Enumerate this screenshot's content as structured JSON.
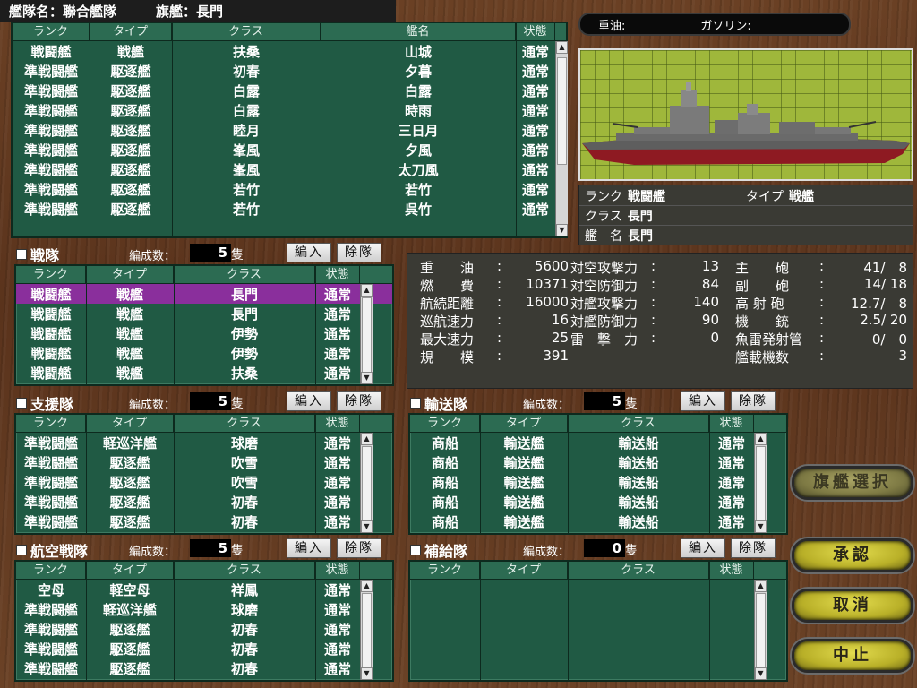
{
  "fleet_header": {
    "name_label": "艦隊名：",
    "name": "聯合艦隊",
    "flagship_label": "旗艦：",
    "flagship": "長門"
  },
  "top_list": {
    "headers": [
      "ランク",
      "タイプ",
      "クラス",
      "艦名",
      "状態"
    ],
    "rows": [
      [
        "戦闘艦",
        "戦艦",
        "扶桑",
        "山城",
        "通常"
      ],
      [
        "準戦闘艦",
        "駆逐艦",
        "初春",
        "夕暮",
        "通常"
      ],
      [
        "準戦闘艦",
        "駆逐艦",
        "白露",
        "白露",
        "通常"
      ],
      [
        "準戦闘艦",
        "駆逐艦",
        "白露",
        "時雨",
        "通常"
      ],
      [
        "準戦闘艦",
        "駆逐艦",
        "睦月",
        "三日月",
        "通常"
      ],
      [
        "準戦闘艦",
        "駆逐艦",
        "峯風",
        "夕風",
        "通常"
      ],
      [
        "準戦闘艦",
        "駆逐艦",
        "峯風",
        "太刀風",
        "通常"
      ],
      [
        "準戦闘艦",
        "駆逐艦",
        "若竹",
        "若竹",
        "通常"
      ],
      [
        "準戦闘艦",
        "駆逐艦",
        "若竹",
        "呉竹",
        "通常"
      ]
    ]
  },
  "resources": {
    "heavy_oil_label": "重油:",
    "gasoline_label": "ガソリン:"
  },
  "ship_info": {
    "rank_label": "ランク",
    "rank": "戦闘艦",
    "type_label": "タイプ",
    "type": "戦艦",
    "class_label": "クラス",
    "class": "長門",
    "name_label": "艦　名",
    "name": "長門"
  },
  "stats": {
    "col1": [
      [
        "重　　油",
        "5600"
      ],
      [
        "燃　　費",
        "10371"
      ],
      [
        "航続距離",
        "16000"
      ],
      [
        "巡航速力",
        "16"
      ],
      [
        "最大速力",
        "25"
      ],
      [
        "規　　模",
        "391"
      ]
    ],
    "col2": [
      [
        "対空攻撃力",
        "13"
      ],
      [
        "対空防御力",
        "84"
      ],
      [
        "対艦攻撃力",
        "140"
      ],
      [
        "対艦防御力",
        "90"
      ],
      [
        "雷　撃　力",
        "0"
      ]
    ],
    "col3": [
      [
        "主　　砲",
        "41/　8"
      ],
      [
        "副　　砲",
        "14/ 18"
      ],
      [
        "高 射 砲",
        "12.7/　8"
      ],
      [
        "機　　銃",
        "2.5/ 20"
      ],
      [
        "魚雷発射管",
        "0/　0"
      ],
      [
        "艦載機数",
        "3"
      ]
    ],
    "colon": ":"
  },
  "common": {
    "count_label": "編成数：",
    "unit": "隻",
    "edit_button": "編入",
    "remove_button": "除隊",
    "headers": [
      "ランク",
      "タイプ",
      "クラス",
      "状態"
    ]
  },
  "fleets": {
    "battle": {
      "title": "戦隊",
      "count": "5",
      "rows": [
        [
          "戦闘艦",
          "戦艦",
          "長門",
          "通常"
        ],
        [
          "戦闘艦",
          "戦艦",
          "長門",
          "通常"
        ],
        [
          "戦闘艦",
          "戦艦",
          "伊勢",
          "通常"
        ],
        [
          "戦闘艦",
          "戦艦",
          "伊勢",
          "通常"
        ],
        [
          "戦闘艦",
          "戦艦",
          "扶桑",
          "通常"
        ]
      ]
    },
    "support": {
      "title": "支援隊",
      "count": "5",
      "rows": [
        [
          "準戦闘艦",
          "軽巡洋艦",
          "球磨",
          "通常"
        ],
        [
          "準戦闘艦",
          "駆逐艦",
          "吹雪",
          "通常"
        ],
        [
          "準戦闘艦",
          "駆逐艦",
          "吹雪",
          "通常"
        ],
        [
          "準戦闘艦",
          "駆逐艦",
          "初春",
          "通常"
        ],
        [
          "準戦闘艦",
          "駆逐艦",
          "初春",
          "通常"
        ]
      ]
    },
    "air": {
      "title": "航空戦隊",
      "count": "5",
      "rows": [
        [
          "空母",
          "軽空母",
          "祥鳳",
          "通常"
        ],
        [
          "準戦闘艦",
          "軽巡洋艦",
          "球磨",
          "通常"
        ],
        [
          "準戦闘艦",
          "駆逐艦",
          "初春",
          "通常"
        ],
        [
          "準戦闘艦",
          "駆逐艦",
          "初春",
          "通常"
        ],
        [
          "準戦闘艦",
          "駆逐艦",
          "初春",
          "通常"
        ]
      ]
    },
    "transport": {
      "title": "輸送隊",
      "count": "5",
      "rows": [
        [
          "商船",
          "輸送艦",
          "輸送船",
          "通常"
        ],
        [
          "商船",
          "輸送艦",
          "輸送船",
          "通常"
        ],
        [
          "商船",
          "輸送艦",
          "輸送船",
          "通常"
        ],
        [
          "商船",
          "輸送艦",
          "輸送船",
          "通常"
        ],
        [
          "商船",
          "輸送艦",
          "輸送船",
          "通常"
        ]
      ]
    },
    "supply": {
      "title": "補給隊",
      "count": "0",
      "rows": []
    }
  },
  "actions": {
    "flagship_select": "旗艦選択",
    "approve": "承認",
    "cancel": "取消",
    "abort": "中止"
  }
}
